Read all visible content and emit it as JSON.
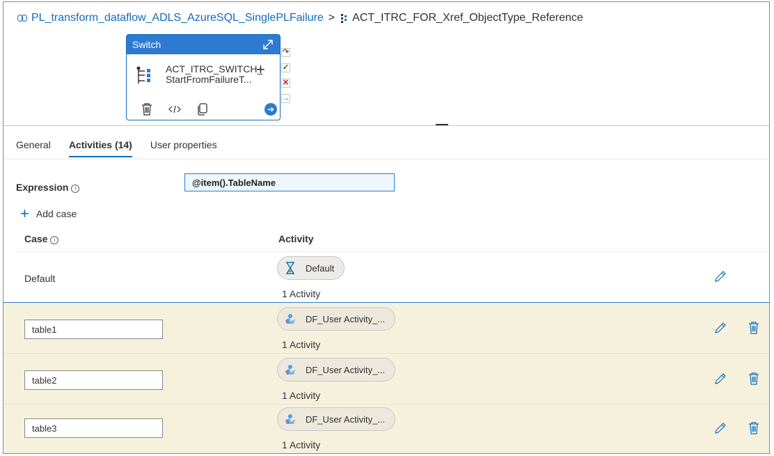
{
  "breadcrumb": {
    "pipeline": "PL_transform_dataflow_ADLS_AzureSQL_SinglePLFailure",
    "separator": ">",
    "activity": "ACT_ITRC_FOR_Xref_ObjectType_Reference"
  },
  "switch_card": {
    "title": "Switch",
    "name_line1": "ACT_ITRC_SWITCH_",
    "name_line2": "StartFromFailureT...",
    "plus": "+"
  },
  "tabs": [
    {
      "label": "General"
    },
    {
      "label": "Activities (14)"
    },
    {
      "label": "User properties"
    }
  ],
  "expression": {
    "label": "Expression",
    "value": "@item().TableName"
  },
  "add_case_label": "Add case",
  "columns": {
    "case": "Case",
    "activity": "Activity"
  },
  "default_row": {
    "case": "Default",
    "activity": "Default",
    "count": "1 Activity"
  },
  "case_rows": [
    {
      "case": "table1",
      "activity": "DF_User Activity_...",
      "count": "1 Activity"
    },
    {
      "case": "table2",
      "activity": "DF_User Activity_...",
      "count": "1 Activity"
    },
    {
      "case": "table3",
      "activity": "DF_User Activity_...",
      "count": "1 Activity"
    }
  ],
  "colors": {
    "accent": "#0f6cbd",
    "card_header": "#2e7ad1",
    "row_highlight": "#f6f1dd"
  },
  "icons": {
    "breadcrumb_pipeline": "pipeline-icon",
    "breadcrumb_activity": "foreach-icon",
    "expand": "expand-icon",
    "switch": "switch-activity-icon",
    "delete": "trash-icon",
    "code": "code-icon",
    "copy": "copy-icon",
    "navigate": "arrow-right-circle-icon",
    "skipped": "skip-icon",
    "success": "checkmark-icon",
    "failure": "x-icon",
    "completion": "arrow-right-icon",
    "default_activity": "hourglass-icon",
    "dataflow_activity": "dataflow-icon",
    "edit": "pencil-icon"
  }
}
